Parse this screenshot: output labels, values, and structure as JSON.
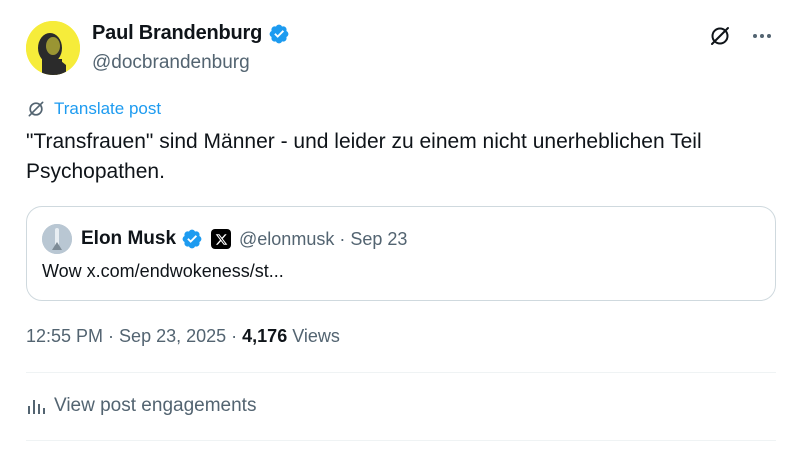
{
  "author": {
    "name": "Paul Brandenburg",
    "handle": "@docbrandenburg",
    "verified": true
  },
  "translate_label": "Translate post",
  "post_text": "\"Transfrauen\" sind Männer - und leider zu einem nicht unerheblichen Teil Psychopathen.",
  "quote": {
    "name": "Elon Musk",
    "handle": "@elonmusk",
    "separator": "·",
    "date": "Sep 23",
    "text": "Wow x.com/endwokeness/st..."
  },
  "meta": {
    "time": "12:55 PM",
    "separator": "·",
    "date": "Sep 23, 2025",
    "views_count": "4,176",
    "views_label": "Views"
  },
  "engagements_label": "View post engagements",
  "colors": {
    "accent": "#1d9bf0",
    "muted": "#536471",
    "text": "#0f1419",
    "border": "#cfd9de",
    "avatar_bg": "#f6ec3a"
  },
  "icons": [
    "verified-icon",
    "grok-icon",
    "more-icon",
    "translate-icon",
    "x-logo-icon",
    "analytics-icon"
  ]
}
